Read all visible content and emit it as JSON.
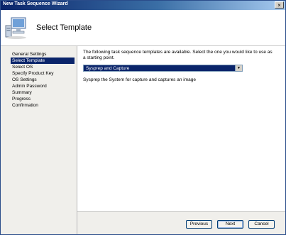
{
  "window": {
    "title": "New Task Sequence Wizard",
    "close_glyph": "×"
  },
  "header": {
    "title": "Select Template",
    "icon": "computer-wizard-icon"
  },
  "steps": [
    {
      "label": "General Settings",
      "active": false
    },
    {
      "label": "Select Template",
      "active": true
    },
    {
      "label": "Select OS",
      "active": false
    },
    {
      "label": "Specify Product Key",
      "active": false
    },
    {
      "label": "OS Settings",
      "active": false
    },
    {
      "label": "Admin Password",
      "active": false
    },
    {
      "label": "Summary",
      "active": false
    },
    {
      "label": "Progress",
      "active": false
    },
    {
      "label": "Confirmation",
      "active": false
    }
  ],
  "content": {
    "intro": "The following task sequence templates are available.  Select the one you would like to use as a starting point.",
    "template_select": {
      "value": "Sysprep and Capture",
      "arrow": "▼"
    },
    "description": "Sysprep the System for capture and captures an image"
  },
  "buttons": {
    "previous": "Previous",
    "next": "Next",
    "cancel": "Cancel"
  },
  "colors": {
    "selection": "#0a246a",
    "title_bar": "#0a246a"
  }
}
